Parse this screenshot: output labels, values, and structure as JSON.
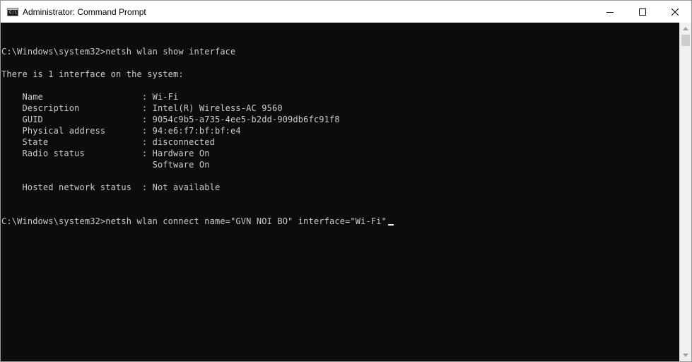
{
  "window": {
    "title": "Administrator: Command Prompt",
    "icon": "cmd-icon",
    "icon_text": "C:\\",
    "controls": [
      "minimize-icon",
      "maximize-icon",
      "close-icon"
    ]
  },
  "console": {
    "lines": [
      "C:\\Windows\\system32>netsh wlan show interface",
      "",
      "There is 1 interface on the system:",
      "",
      "    Name                   : Wi-Fi",
      "    Description            : Intel(R) Wireless-AC 9560",
      "    GUID                   : 9054c9b5-a735-4ee5-b2dd-909db6fc91f8",
      "    Physical address       : 94:e6:f7:bf:bf:e4",
      "    State                  : disconnected",
      "    Radio status           : Hardware On",
      "                             Software On",
      "",
      "    Hosted network status  : Not available",
      "",
      ""
    ],
    "prompt_line": "C:\\Windows\\system32>netsh wlan connect name=\"GVN NOI BO\" interface=\"Wi-Fi\"",
    "text_color": "#cccccc",
    "background": "#0c0c0c"
  }
}
